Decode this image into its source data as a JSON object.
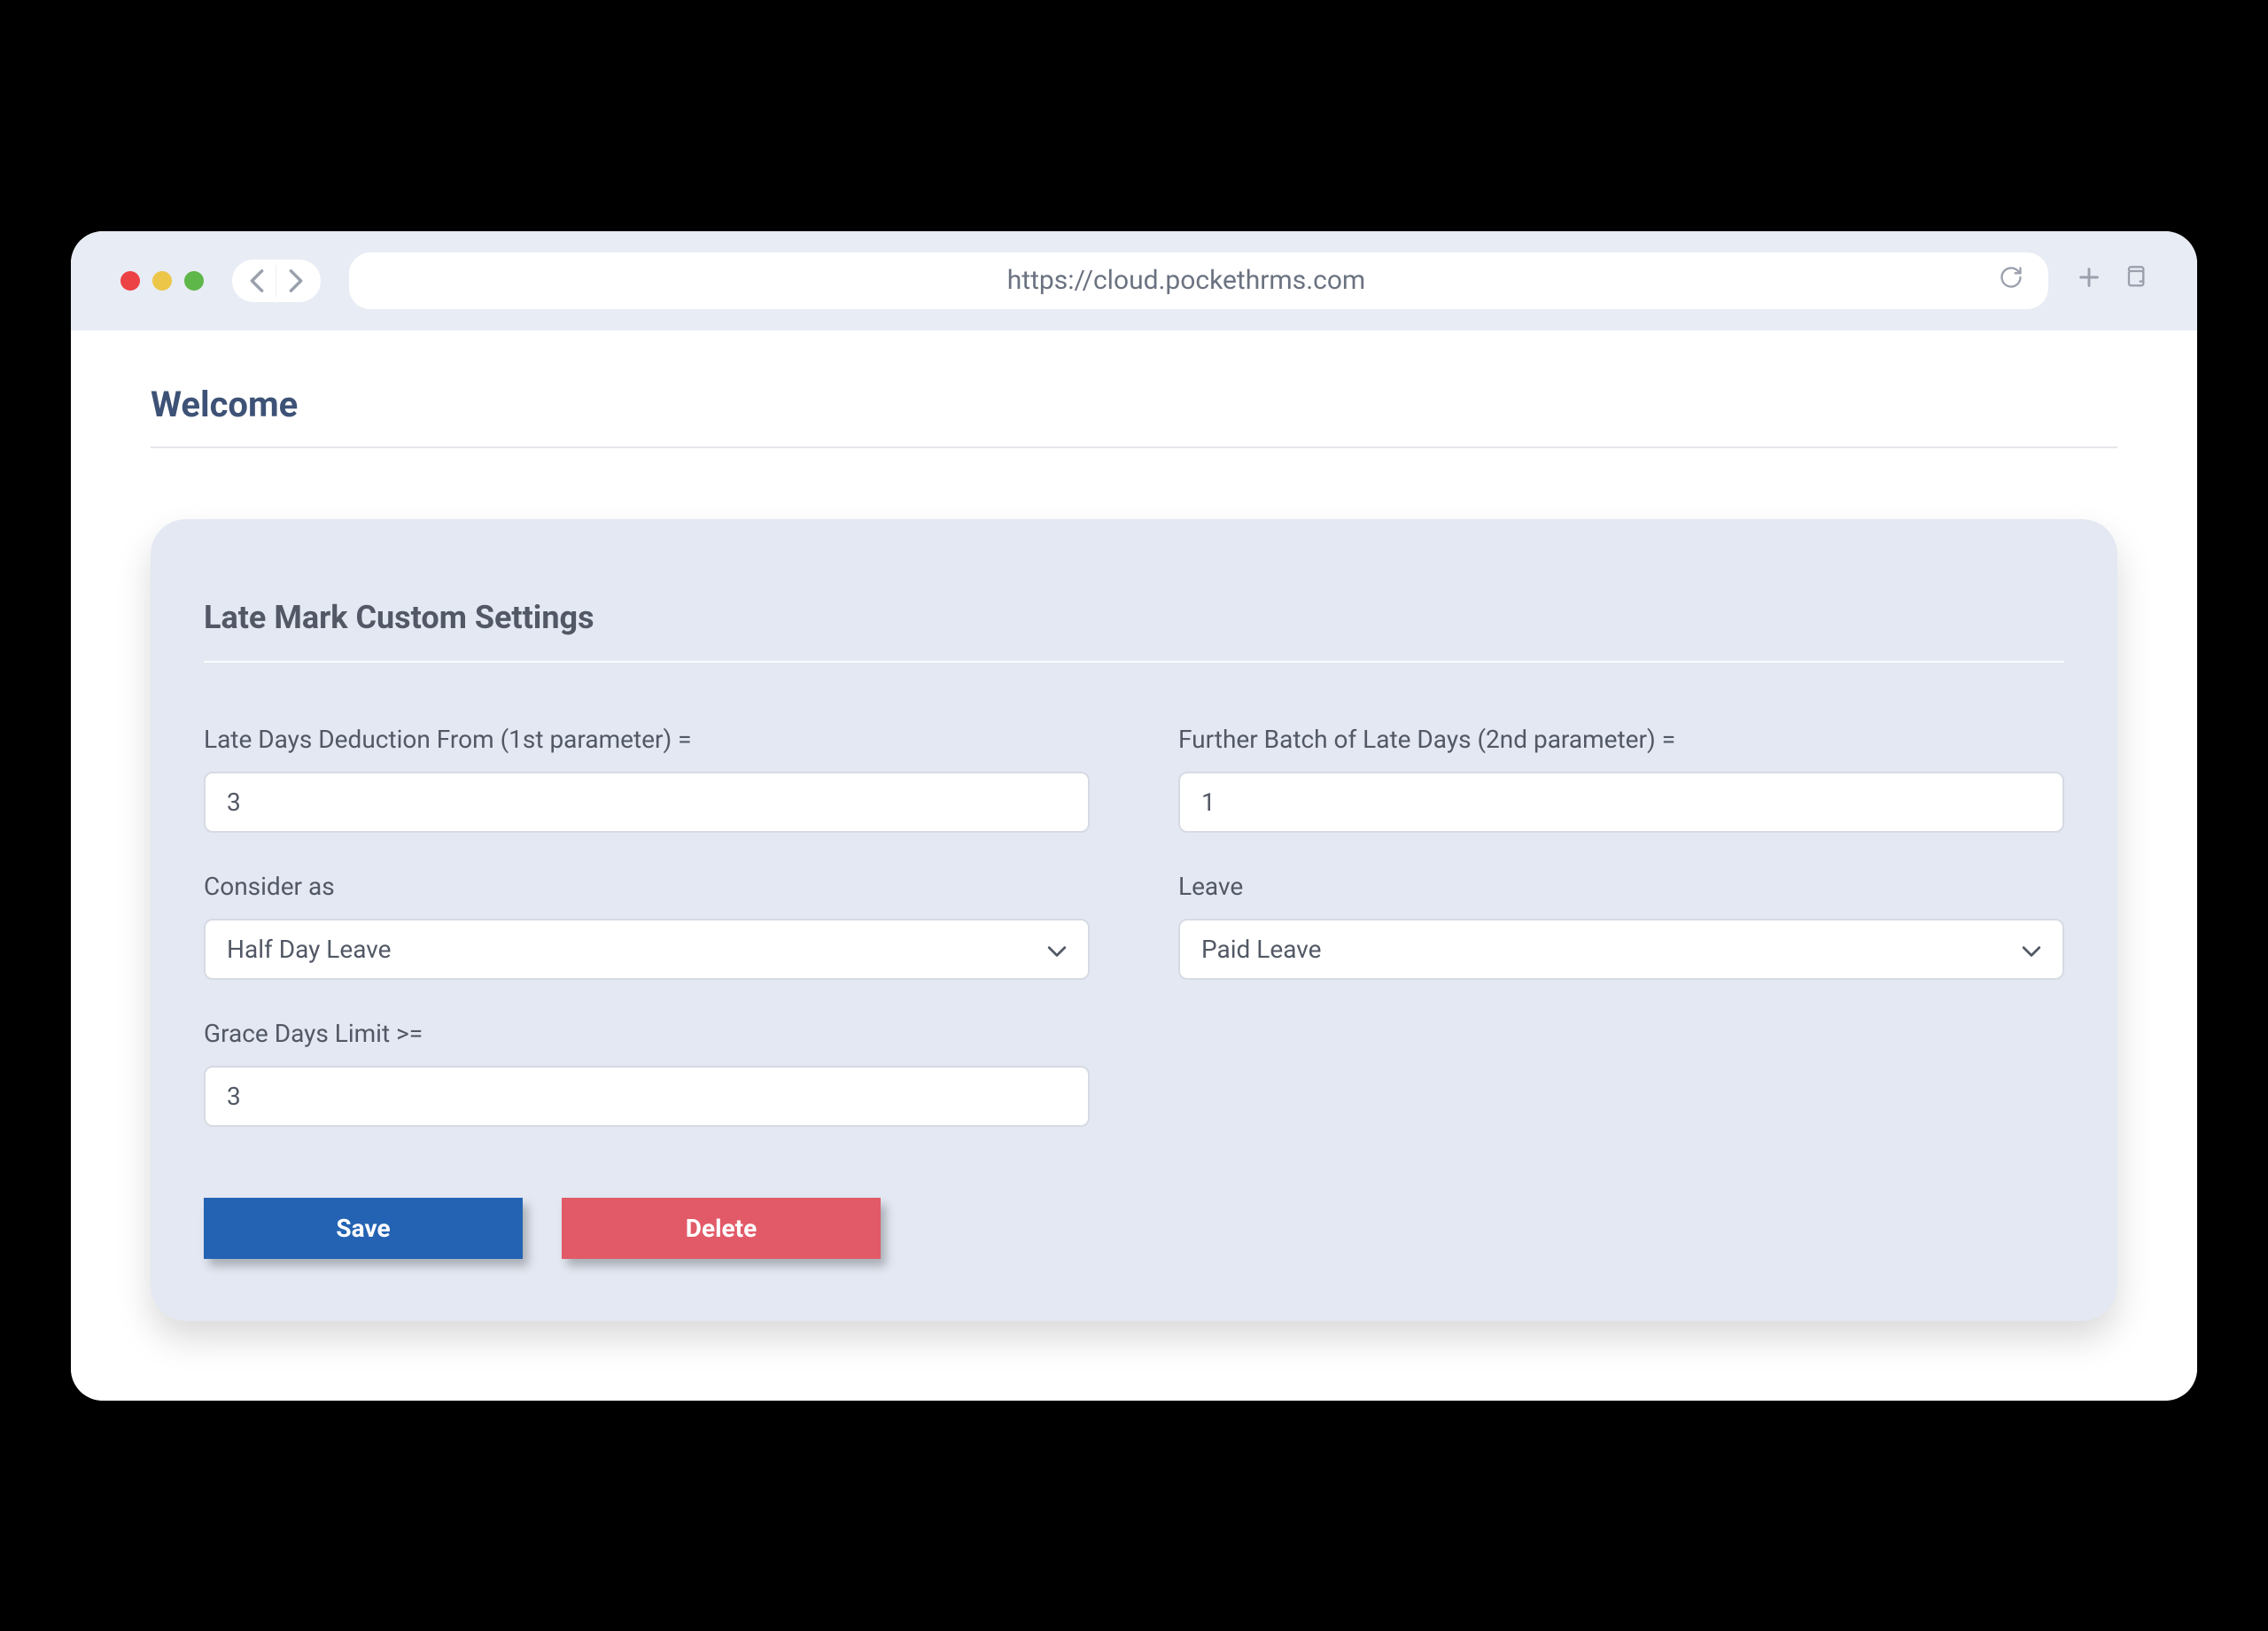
{
  "browser": {
    "url": "https://cloud.pockethrms.com"
  },
  "page": {
    "title": "Welcome"
  },
  "card": {
    "title": "Late Mark Custom Settings"
  },
  "form": {
    "late_days_label": "Late Days Deduction From (1st parameter) =",
    "late_days_value": "3",
    "further_batch_label": "Further Batch of Late Days (2nd parameter) =",
    "further_batch_value": "1",
    "consider_as_label": "Consider as",
    "consider_as_value": "Half Day Leave",
    "leave_label": "Leave",
    "leave_value": "Paid Leave",
    "grace_days_label": "Grace Days Limit >=",
    "grace_days_value": "3",
    "save_button": "Save",
    "delete_button": "Delete"
  }
}
